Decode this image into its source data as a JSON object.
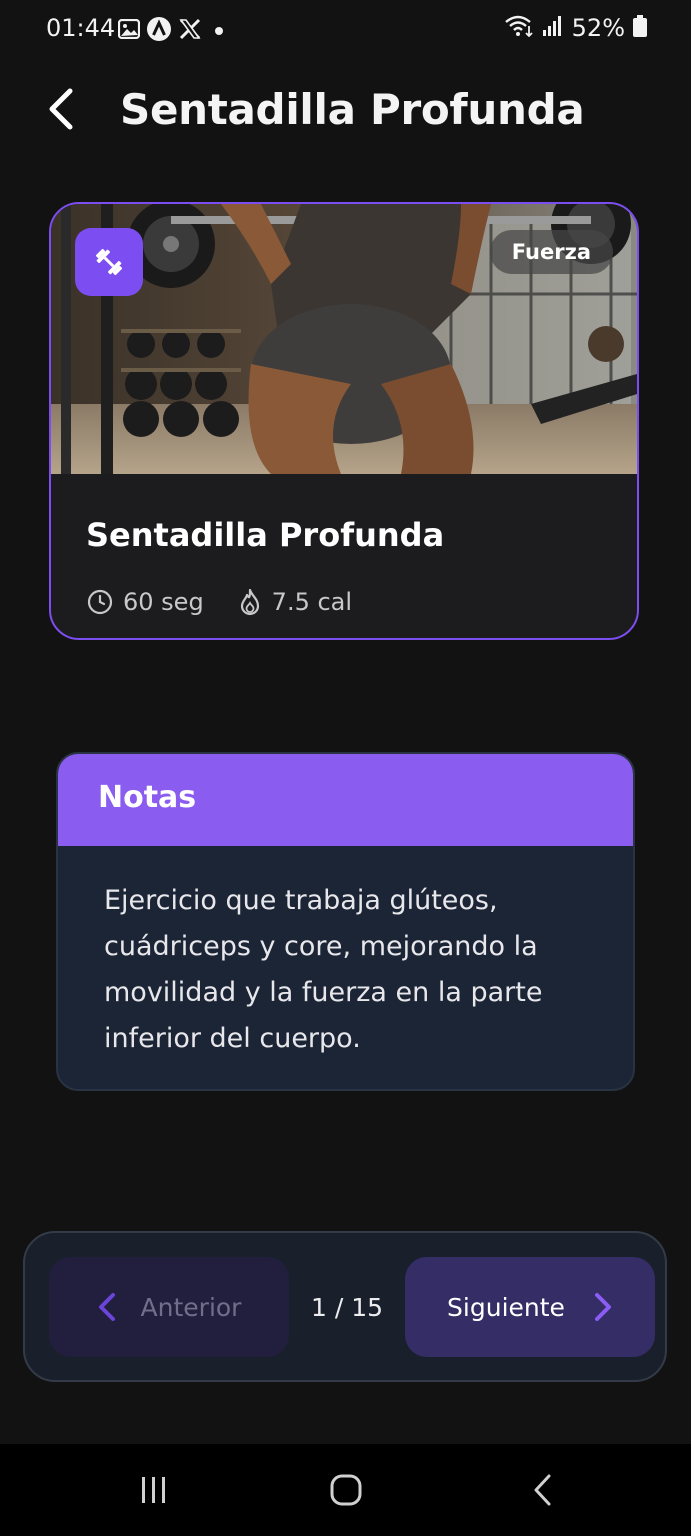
{
  "status_bar": {
    "time": "01:44",
    "battery": "52%",
    "icons_left": [
      "gallery-icon",
      "a-app-icon",
      "x-app-icon",
      "dot-icon"
    ],
    "icons_right": [
      "wifi-icon",
      "signal-icon",
      "battery-icon"
    ]
  },
  "header": {
    "title": "Sentadilla Profunda"
  },
  "exercise": {
    "name": "Sentadilla Profunda",
    "category": "Fuerza",
    "duration": "60 seg",
    "calories": "7.5 cal",
    "category_icon": "dumbbell-icon"
  },
  "notes": {
    "title": "Notas",
    "body": "Ejercicio que trabaja glúteos, cuádriceps y core, mejorando la movilidad y la fuerza en la parte inferior del cuerpo."
  },
  "navigation": {
    "prev_label": "Anterior",
    "next_label": "Siguiente",
    "page_indicator": "1 / 15"
  },
  "colors": {
    "accent": "#7c4df0",
    "notes_header": "#8b5cf0",
    "background": "#121212",
    "card": "#1c1c1e",
    "notes_card": "#1c2535"
  }
}
